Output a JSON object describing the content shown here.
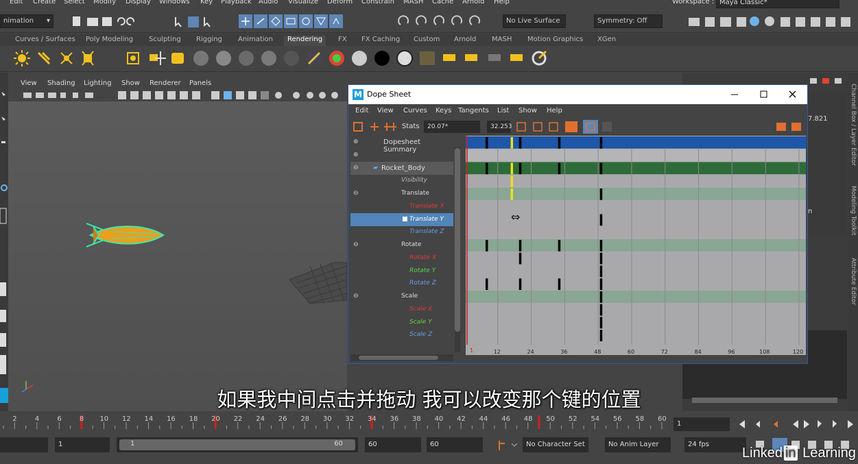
{
  "menubar": {
    "items": [
      "Edit",
      "Create",
      "Select",
      "Modify",
      "Display",
      "Windows",
      "Key",
      "Playback",
      "Audio",
      "Visualize",
      "Deform",
      "Constrain",
      "MASH",
      "Cache",
      "Arnold",
      "Help"
    ],
    "workspace_label": "Workspace :",
    "workspace_value": "Maya Classic*"
  },
  "statusline": {
    "mode": "nimation",
    "live_surface": "No Live Surface",
    "symmetry": "Symmetry: Off"
  },
  "shelf_tabs": [
    "Curves / Surfaces",
    "Poly Modeling",
    "Sculpting",
    "Rigging",
    "Animation",
    "Rendering",
    "FX",
    "FX Caching",
    "Custom",
    "Arnold",
    "MASH",
    "Motion Graphics",
    "XGen"
  ],
  "shelf_active": "Rendering",
  "panel_menu": [
    "View",
    "Shading",
    "Lighting",
    "Show",
    "Renderer",
    "Panels"
  ],
  "right_panel": {
    "value": "7.821",
    "fragment": "n",
    "vertical_tabs": [
      "Channel Box / Layer Editor",
      "Modeling Toolkit",
      "Attribute Editor"
    ]
  },
  "dope_sheet": {
    "title": "Dope Sheet",
    "menu": [
      "Edit",
      "View",
      "Curves",
      "Keys",
      "Tangents",
      "List",
      "Show",
      "Help"
    ],
    "stats_label": "Stats",
    "stats_value1": "20.07*",
    "stats_value2": "32.253",
    "outliner": [
      {
        "label": "Dopesheet Summary",
        "color": "#dddddd",
        "italic": false
      },
      {
        "label": "",
        "color": "#dddddd",
        "italic": false
      },
      {
        "label": "Rocket_Body",
        "color": "#dddddd",
        "italic": false
      },
      {
        "label": "Visibility",
        "color": "#bbbbbb",
        "italic": true
      },
      {
        "label": "Translate",
        "color": "#dddddd",
        "italic": false
      },
      {
        "label": "Translate X",
        "color": "#e03a3a",
        "italic": true
      },
      {
        "label": "Translate Y",
        "color": "#ffffff",
        "italic": true
      },
      {
        "label": "Translate Z",
        "color": "#6a9de8",
        "italic": true
      },
      {
        "label": "Rotate",
        "color": "#dddddd",
        "italic": false
      },
      {
        "label": "Rotate X",
        "color": "#e03a3a",
        "italic": true
      },
      {
        "label": "Rotate Y",
        "color": "#5fd24a",
        "italic": true
      },
      {
        "label": "Rotate Z",
        "color": "#6a9de8",
        "italic": true
      },
      {
        "label": "Scale",
        "color": "#dddddd",
        "italic": false
      },
      {
        "label": "Scale X",
        "color": "#e03a3a",
        "italic": true
      },
      {
        "label": "Scale Y",
        "color": "#5fd24a",
        "italic": true
      },
      {
        "label": "Scale Z",
        "color": "#6a9de8",
        "italic": true
      }
    ],
    "ruler_start": "1",
    "ruler": [
      "12",
      "24",
      "36",
      "48",
      "60",
      "72",
      "84",
      "96",
      "108",
      "120"
    ]
  },
  "timeline": {
    "ticks": [
      "2",
      "4",
      "6",
      "8",
      "10",
      "12",
      "14",
      "16",
      "18",
      "20",
      "22",
      "24",
      "26",
      "28",
      "30",
      "32",
      "34",
      "36",
      "38",
      "40",
      "42",
      "44",
      "46",
      "48",
      "50",
      "52",
      "54",
      "56",
      "58",
      "60"
    ],
    "current_frame": "1"
  },
  "range": {
    "start": "1",
    "inner_start": "1",
    "slider_start": "1",
    "slider_end": "60",
    "inner_end": "60",
    "end": "60",
    "character_set": "No Character Set",
    "anim_layer": "No Anim Layer",
    "fps": "24 fps"
  },
  "subtitle": "如果我中间点击并拖动 我可以改变那个键的位置",
  "watermark": "Linked in Learning"
}
